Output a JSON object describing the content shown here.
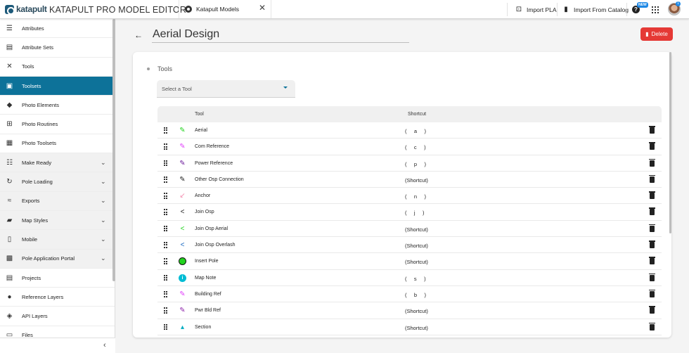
{
  "topbar": {
    "logo_text": "katapult",
    "app_title": "KATAPULT PRO MODEL EDITOR",
    "tab_label": "Katapult Models",
    "tab_close": "✕",
    "import_pla": "Import PLA",
    "import_catalog": "Import From Catalog",
    "help": "?",
    "new_badge": "NEW",
    "notification_count": "1"
  },
  "sidebar": {
    "items": [
      {
        "label": "Attributes",
        "icon": "list-icon",
        "glyph": "☰"
      },
      {
        "label": "Attribute Sets",
        "icon": "table-icon",
        "glyph": "▤"
      },
      {
        "label": "Tools",
        "icon": "tools-icon",
        "glyph": "✕"
      },
      {
        "label": "Toolsets",
        "icon": "toolbox-icon",
        "glyph": "▣"
      },
      {
        "label": "Photo Elements",
        "icon": "shapes-icon",
        "glyph": "◆"
      },
      {
        "label": "Photo Routines",
        "icon": "add-box-icon",
        "glyph": "⊞"
      },
      {
        "label": "Photo Toolsets",
        "icon": "photo-library-icon",
        "glyph": "▦"
      },
      {
        "label": "Make Ready",
        "icon": "format-list-icon",
        "glyph": "☷"
      },
      {
        "label": "Pole Loading",
        "icon": "rotate-icon",
        "glyph": "↻"
      },
      {
        "label": "Exports",
        "icon": "multiline-chart-icon",
        "glyph": "≈"
      },
      {
        "label": "Map Styles",
        "icon": "map-icon",
        "glyph": "▰"
      },
      {
        "label": "Mobile",
        "icon": "phone-icon",
        "glyph": "▯"
      },
      {
        "label": "Pole Application Portal",
        "icon": "inbox-chart-icon",
        "glyph": "▩"
      },
      {
        "label": "Projects",
        "icon": "assignment-icon",
        "glyph": "▤"
      },
      {
        "label": "Reference Layers",
        "icon": "place-icon",
        "glyph": "●"
      },
      {
        "label": "API Layers",
        "icon": "layers-icon",
        "glyph": "◈"
      },
      {
        "label": "Files",
        "icon": "file-icon",
        "glyph": "▭"
      }
    ],
    "collapse": "‹"
  },
  "page": {
    "title": "Aerial Design",
    "back": "←",
    "delete_label": "Delete",
    "section_title": "Tools",
    "select_placeholder": "Select a Tool"
  },
  "table": {
    "col_tool": "Tool",
    "col_shortcut": "Shortcut",
    "rows": [
      {
        "name": "Aerial",
        "shortcut": "(     a     )",
        "icon": "pencil-icon",
        "color": "#22d31f",
        "glyph": "✎"
      },
      {
        "name": "Com Reference",
        "shortcut": "(     c     )",
        "icon": "pencil-icon",
        "color": "#e040fb",
        "glyph": "✎"
      },
      {
        "name": "Power Reference",
        "shortcut": "(     p     )",
        "icon": "pencil-icon",
        "color": "#6a1b9a",
        "glyph": "✎"
      },
      {
        "name": "Other Osp Connection",
        "shortcut": "(Shortcut)",
        "icon": "pencil-icon",
        "color": "#222222",
        "glyph": "✎"
      },
      {
        "name": "Anchor",
        "shortcut": "(     n     )",
        "icon": "arrow-icon",
        "color": "#f48fb1",
        "glyph": "↙"
      },
      {
        "name": "Join Osp",
        "shortcut": "(     j     )",
        "icon": "share-icon",
        "color": "#222222",
        "glyph": "<"
      },
      {
        "name": "Join Osp Aerial",
        "shortcut": "(Shortcut)",
        "icon": "share-icon",
        "color": "#22d31f",
        "glyph": "<"
      },
      {
        "name": "Join Osp Overlash",
        "shortcut": "(Shortcut)",
        "icon": "share-icon",
        "color": "#1565c0",
        "glyph": "<"
      },
      {
        "name": "Insert Pole",
        "shortcut": "(Shortcut)",
        "icon": "circle-icon",
        "color": "#22d31f",
        "glyph": ""
      },
      {
        "name": "Map Note",
        "shortcut": "(     s     )",
        "icon": "info-icon",
        "color": "#00bcd4",
        "glyph": "i"
      },
      {
        "name": "Building Ref",
        "shortcut": "(     b     )",
        "icon": "pencil-icon",
        "color": "#e040fb",
        "glyph": "✎"
      },
      {
        "name": "Pwr Bld Ref",
        "shortcut": "(Shortcut)",
        "icon": "pencil-icon",
        "color": "#8e24aa",
        "glyph": "✎"
      },
      {
        "name": "Section",
        "shortcut": "(Shortcut)",
        "icon": "caret-up-icon",
        "color": "#00acc1",
        "glyph": "▴"
      }
    ]
  },
  "colors": {
    "accent": "#0d7299",
    "danger": "#e53935"
  }
}
